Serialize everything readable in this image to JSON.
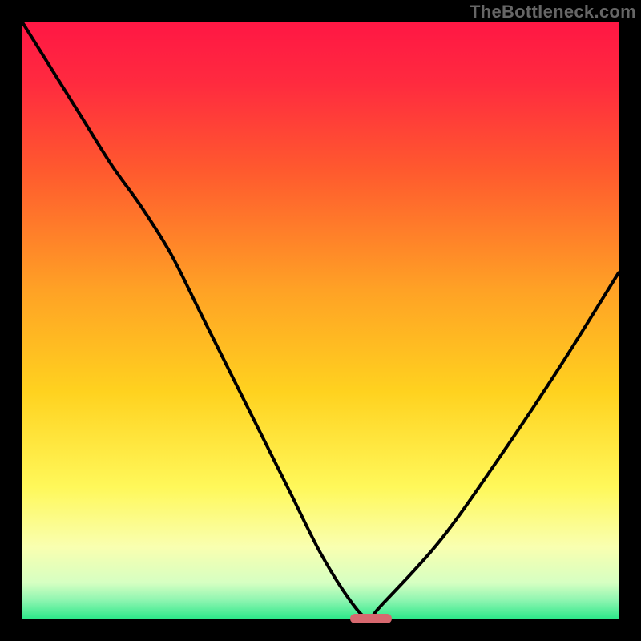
{
  "watermark": "TheBottleneck.com",
  "colors": {
    "frame": "#000000",
    "gradient_stops": [
      {
        "offset": 0.0,
        "color": "#ff1744"
      },
      {
        "offset": 0.1,
        "color": "#ff2a3f"
      },
      {
        "offset": 0.25,
        "color": "#ff5a2e"
      },
      {
        "offset": 0.45,
        "color": "#ffa225"
      },
      {
        "offset": 0.62,
        "color": "#ffd21f"
      },
      {
        "offset": 0.78,
        "color": "#fff85a"
      },
      {
        "offset": 0.88,
        "color": "#f9ffb0"
      },
      {
        "offset": 0.94,
        "color": "#d6ffc2"
      },
      {
        "offset": 0.97,
        "color": "#8cf5b0"
      },
      {
        "offset": 1.0,
        "color": "#2ee88a"
      }
    ],
    "curve": "#000000",
    "marker": "#d7686f"
  },
  "chart_data": {
    "type": "line",
    "title": "",
    "xlabel": "",
    "ylabel": "",
    "xlim": [
      0,
      1
    ],
    "ylim": [
      0,
      1
    ],
    "x": [
      0.0,
      0.05,
      0.1,
      0.15,
      0.2,
      0.25,
      0.3,
      0.35,
      0.4,
      0.45,
      0.5,
      0.55,
      0.58,
      0.6,
      0.7,
      0.8,
      0.9,
      1.0
    ],
    "values": [
      1.0,
      0.92,
      0.84,
      0.76,
      0.69,
      0.61,
      0.51,
      0.41,
      0.31,
      0.21,
      0.11,
      0.03,
      0.0,
      0.02,
      0.13,
      0.27,
      0.42,
      0.58
    ],
    "annotations": [],
    "legend": []
  },
  "marker": {
    "x_start": 0.55,
    "x_end": 0.62,
    "y": 0.0
  }
}
